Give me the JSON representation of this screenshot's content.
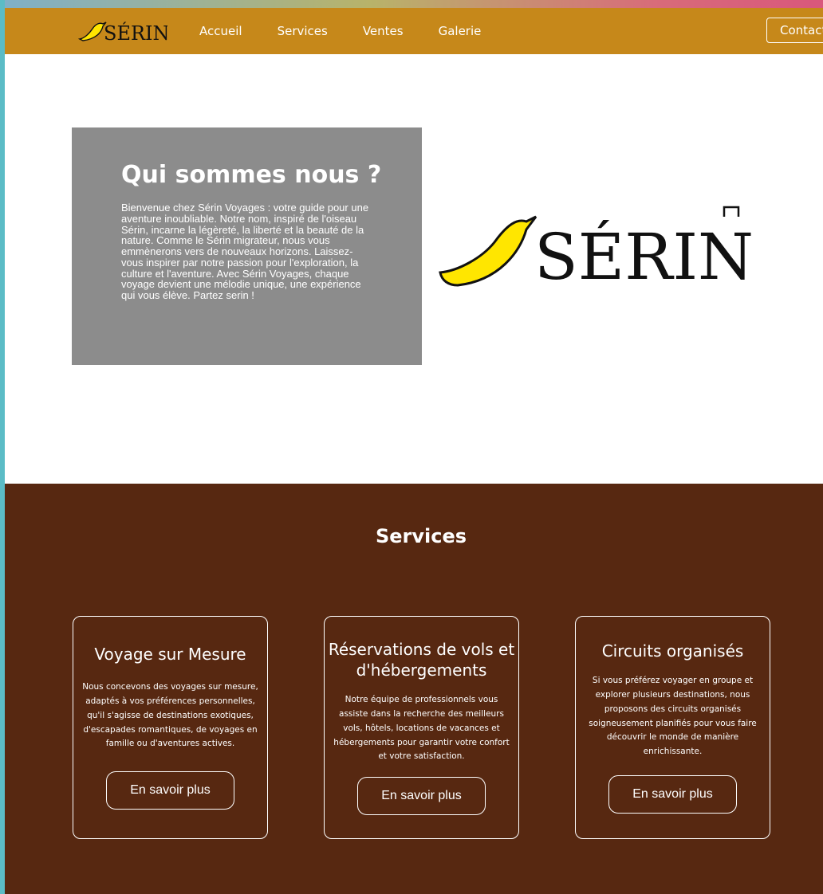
{
  "nav": {
    "brand": "SÉRIN",
    "links": [
      "Accueil",
      "Services",
      "Ventes",
      "Galerie"
    ],
    "contact": "Contact"
  },
  "about": {
    "title": "Qui sommes nous ?",
    "text": "Bienvenue chez Sérin Voyages : votre guide pour une aventure inoubliable. Notre nom, inspiré de l'oiseau Sérin, incarne la légèreté, la liberté et la beauté de la nature. Comme le Sérin migrateur, nous vous emmènerons vers de nouveaux horizons. Laissez-vous inspirer par notre passion pour l'exploration, la culture et l'aventure. Avec Sérin Voyages, chaque voyage devient une mélodie unique, une expérience qui vous élève. Partez serin !"
  },
  "hero_logo": {
    "brand": "SÉRIN"
  },
  "services": {
    "title": "Services",
    "cards": [
      {
        "title": "Voyage sur Mesure",
        "text": "Nous concevons des voyages sur mesure, adaptés à vos préférences personnelles, qu'il s'agisse de destinations exotiques, d'escapades romantiques, de voyages en famille ou d'aventures actives.",
        "button": "En savoir plus"
      },
      {
        "title": "Réservations de vols et d'hébergements",
        "text": "Notre équipe de professionnels vous assiste dans la recherche des meilleurs vols, hôtels, locations de vacances et hébergements pour garantir votre confort et votre satisfaction.",
        "button": "En savoir plus"
      },
      {
        "title": "Circuits organisés",
        "text": "Si vous préférez voyager en groupe et explorer plusieurs destinations, nous proposons des circuits organisés soigneusement planifiés pour vous faire découvrir le monde de manière enrichissante.",
        "button": "En savoir plus"
      }
    ]
  },
  "colors": {
    "nav_bg": "#c6881a",
    "about_bg": "#8c8c8c",
    "services_bg": "#572811",
    "bird_yellow": "#ffe600"
  }
}
